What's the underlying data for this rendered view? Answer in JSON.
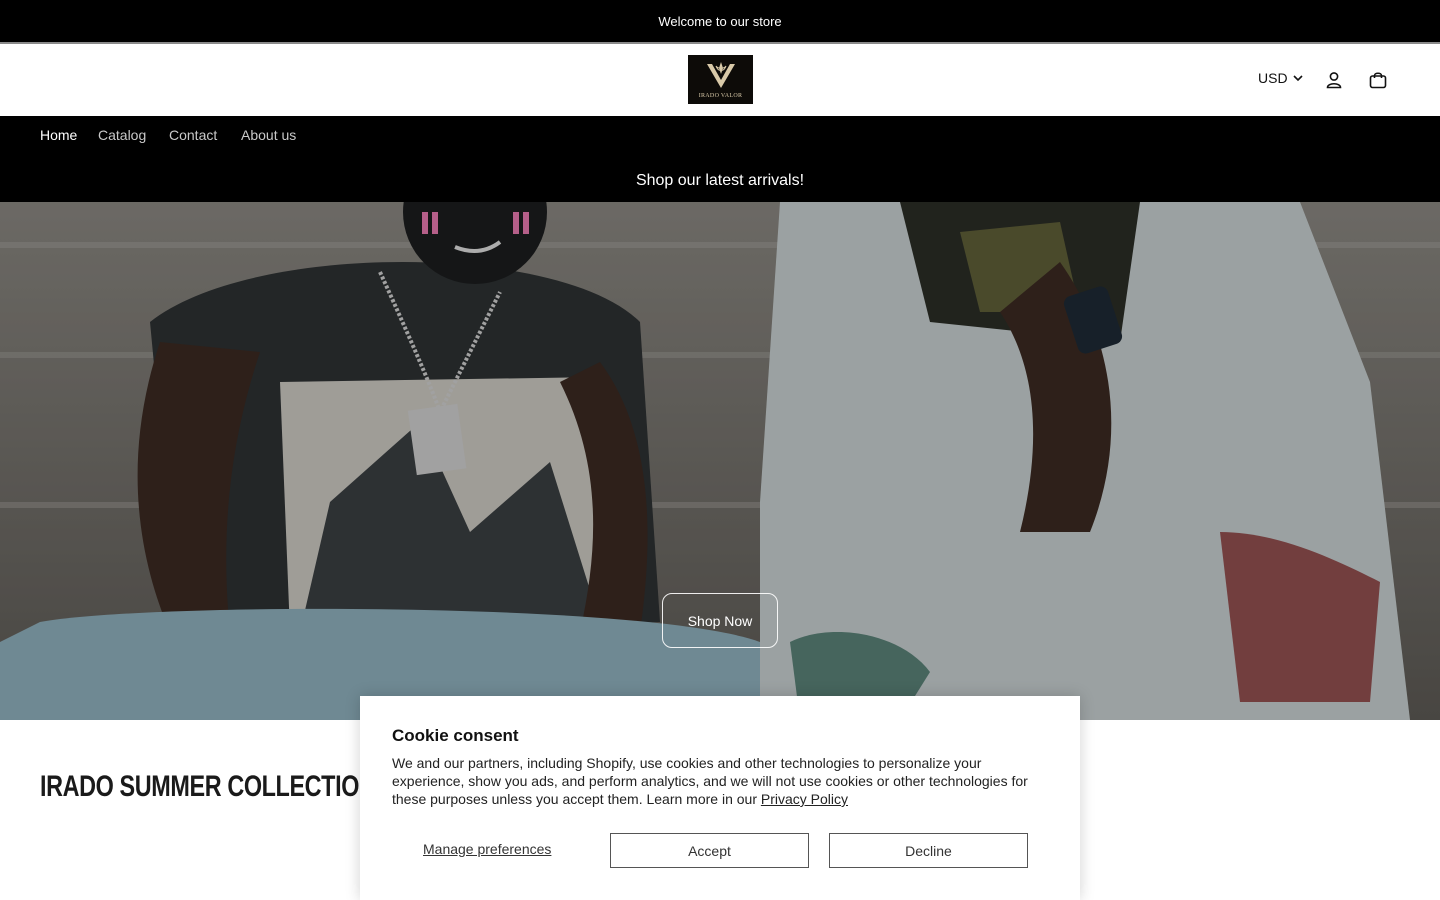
{
  "announcement": {
    "text": "Welcome to our store"
  },
  "header": {
    "logo_text": "IRADO VALOR",
    "currency": "USD",
    "account_icon": "account-icon",
    "cart_icon": "cart-icon"
  },
  "nav": {
    "items": [
      {
        "label": "Home",
        "active": true
      },
      {
        "label": "Catalog",
        "active": false
      },
      {
        "label": "Contact",
        "active": false
      },
      {
        "label": "About us",
        "active": false
      }
    ]
  },
  "promo": {
    "text": "Shop our latest arrivals!"
  },
  "hero": {
    "button_label": "Shop Now"
  },
  "collection": {
    "title": "IRADO SUMMER COLLECTION"
  },
  "cookie": {
    "title": "Cookie consent",
    "body": "We and our partners, including Shopify, use cookies and other technologies to personalize your experience, show you ads, and perform analytics, and we will not use cookies or other technologies for these purposes unless you accept them. Learn more in our ",
    "privacy_link": "Privacy Policy",
    "manage_label": "Manage preferences",
    "accept_label": "Accept",
    "decline_label": "Decline"
  },
  "colors": {
    "bar_background": "#000000",
    "page_background": "#ffffff",
    "text": "#121212"
  }
}
